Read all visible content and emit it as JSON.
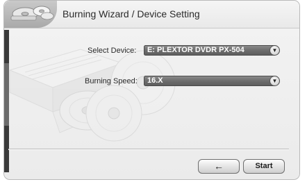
{
  "header": {
    "title": "Burning Wizard / Device Setting",
    "logo_icon": "discs-icon"
  },
  "form": {
    "device_label": "Select Device:",
    "device_value": "E: PLEXTOR DVDR   PX-504",
    "speed_label": "Burning Speed:",
    "speed_value": "16.X"
  },
  "buttons": {
    "back_icon": "left-arrow-icon",
    "back_glyph": "←",
    "start_label": "Start"
  },
  "colors": {
    "select_bg": "#6d6d6d",
    "window_bg": "#ebebeb"
  }
}
